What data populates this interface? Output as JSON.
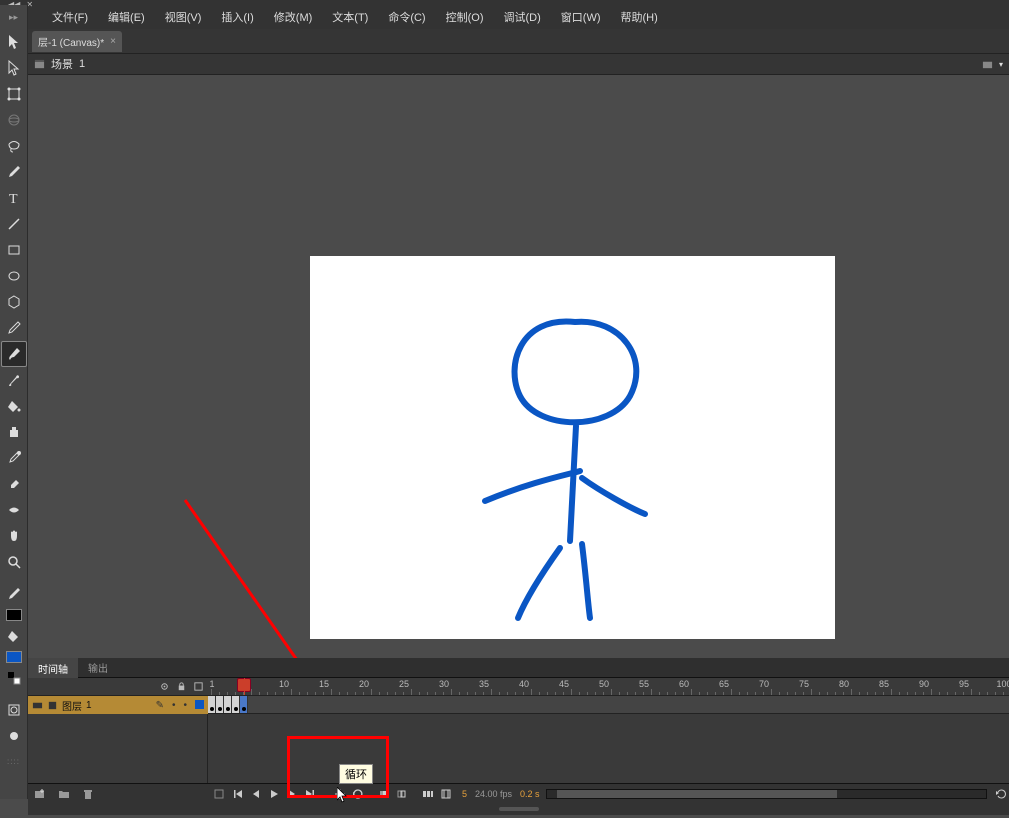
{
  "menu": {
    "file": "文件(F)",
    "edit": "编辑(E)",
    "view": "视图(V)",
    "insert": "插入(I)",
    "modify": "修改(M)",
    "text": "文本(T)",
    "command": "命令(C)",
    "control": "控制(O)",
    "debug": "调试(D)",
    "window": "窗口(W)",
    "help": "帮助(H)"
  },
  "doc_tab": {
    "title": "层-1 (Canvas)*",
    "close": "×"
  },
  "scene": {
    "label": "场景",
    "number": "1"
  },
  "panel_tabs": {
    "timeline": "时间轴",
    "output": "输出"
  },
  "layer": {
    "name": "图层",
    "index": "1"
  },
  "ruler": {
    "marks": [
      1,
      5,
      10,
      15,
      20,
      25,
      30,
      35,
      40,
      45,
      50,
      55,
      60,
      65,
      70,
      75,
      80,
      85,
      90,
      95,
      100
    ]
  },
  "timeline_status": {
    "current_frame": "5",
    "fps": "24.00 fps",
    "time": "0.2 s"
  },
  "tooltip": "循环",
  "colors": {
    "stroke": "#0a56c4",
    "playhead": "#cb3e2a",
    "annot": "#ff0000",
    "layer_bg": "#b58a35"
  }
}
